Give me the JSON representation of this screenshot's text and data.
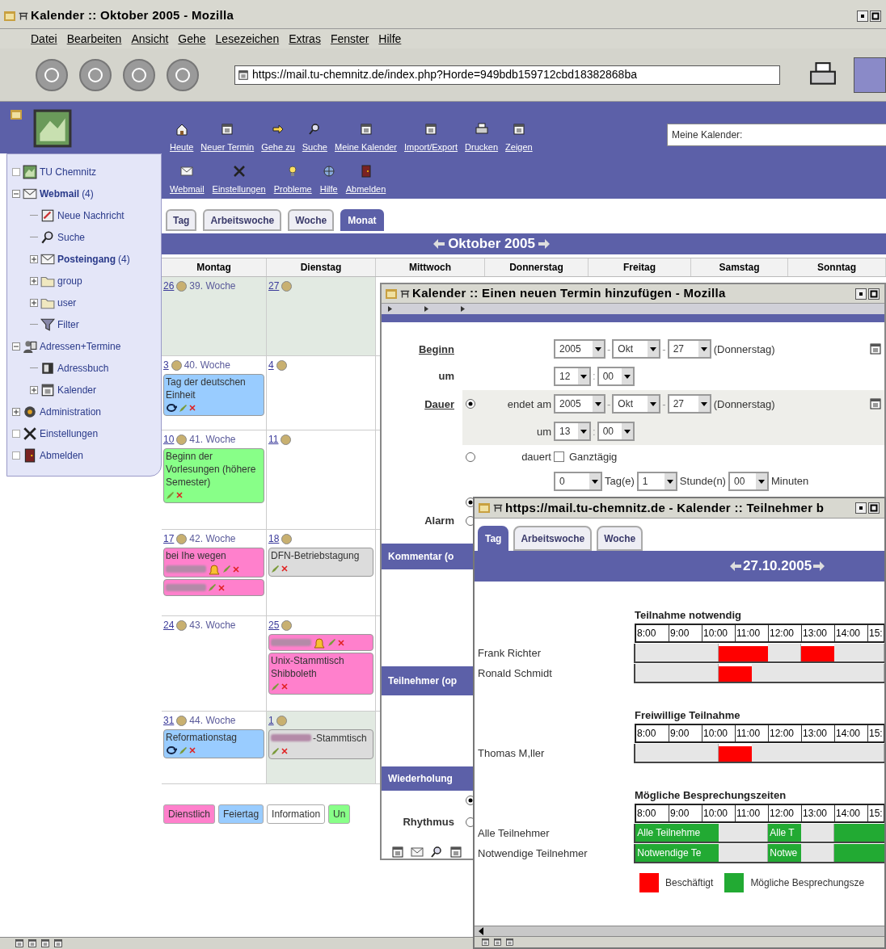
{
  "window": {
    "title": "Kalender :: Oktober 2005 - Mozilla"
  },
  "menu": [
    "Datei",
    "Bearbeiten",
    "Ansicht",
    "Gehe",
    "Lesezeichen",
    "Extras",
    "Fenster",
    "Hilfe"
  ],
  "address_bar": {
    "value": "https://mail.tu-chemnitz.de/index.php?Horde=949bdb159712cbd18382868ba"
  },
  "toolbar": [
    "Heute",
    "Neuer Termin",
    "Gehe zu",
    "Suche",
    "Meine Kalender",
    "Import/Export",
    "Drucken",
    "Zeigen"
  ],
  "toolbar_row2": [
    "Webmail",
    "Einstellungen",
    "Probleme",
    "Hilfe",
    "Abmelden"
  ],
  "calendar_select": {
    "value": "Meine Kalender:"
  },
  "sidebar": {
    "items": [
      {
        "label": "TU Chemnitz",
        "unread": false
      },
      {
        "label": "Webmail",
        "count": "(4)",
        "unread": true,
        "expanded": true,
        "children": [
          {
            "label": "Neue Nachricht",
            "unread": false
          },
          {
            "label": "Suche",
            "unread": false
          },
          {
            "label": "Posteingang",
            "count": "(4)",
            "unread": true,
            "expanded": false
          },
          {
            "label": "group",
            "unread": false,
            "expanded": false
          },
          {
            "label": "user",
            "unread": false,
            "expanded": false
          },
          {
            "label": "Filter",
            "unread": false
          }
        ]
      },
      {
        "label": "Adressen+Termine",
        "unread": false,
        "expanded": true,
        "children": [
          {
            "label": "Adressbuch",
            "unread": false
          },
          {
            "label": "Kalender",
            "unread": false,
            "expanded": false
          }
        ]
      },
      {
        "label": "Administration",
        "unread": false,
        "expanded": false
      },
      {
        "label": "Einstellungen",
        "unread": false
      },
      {
        "label": "Abmelden",
        "unread": false
      }
    ]
  },
  "tabs": [
    {
      "label": "Tag",
      "selected": false
    },
    {
      "label": "Arbeitswoche",
      "selected": false
    },
    {
      "label": "Woche",
      "selected": false
    },
    {
      "label": "Monat",
      "selected": true
    }
  ],
  "month_title": "Oktober 2005",
  "weekdays": [
    "Montag",
    "Dienstag",
    "Mittwoch",
    "Donnerstag",
    "Freitag",
    "Samstag",
    "Sonntag"
  ],
  "weeks": [
    {
      "days": [
        {
          "day": "26",
          "week": "39. Woche",
          "in_month": false
        },
        {
          "day": "27",
          "in_month": false
        }
      ]
    },
    {
      "days": [
        {
          "day": "3",
          "week": "40. Woche",
          "in_month": true,
          "events": [
            {
              "color": "#99ccff",
              "alarm": false,
              "recurring": true,
              "parts": [
                {
                  "kind": "text",
                  "text": "Tag der deutschen Einheit"
                }
              ]
            }
          ]
        },
        {
          "day": "4",
          "in_month": true
        }
      ]
    },
    {
      "days": [
        {
          "day": "10",
          "week": "41. Woche",
          "in_month": true,
          "events": [
            {
              "color": "#88ff88",
              "alarm": false,
              "recurring": false,
              "parts": [
                {
                  "kind": "text",
                  "text": "Beginn der Vorlesungen (höhere Semester)"
                }
              ]
            }
          ]
        },
        {
          "day": "11",
          "in_month": true
        }
      ]
    },
    {
      "days": [
        {
          "day": "17",
          "week": "42. Woche",
          "in_month": true,
          "events": [
            {
              "color": "#ff80cc",
              "alarm": true,
              "recurring": false,
              "parts": [
                {
                  "kind": "text",
                  "text": "bei Ihe wegen"
                },
                {
                  "kind": "blur"
                }
              ]
            },
            {
              "color": "#ff80cc",
              "alarm": false,
              "recurring": false,
              "parts": [
                {
                  "kind": "blur"
                }
              ]
            }
          ]
        },
        {
          "day": "18",
          "in_month": true,
          "events": [
            {
              "color": "#dcdcdc",
              "alarm": false,
              "recurring": false,
              "parts": [
                {
                  "kind": "text",
                  "text": "DFN-Betriebstagung"
                }
              ]
            }
          ]
        }
      ]
    },
    {
      "days": [
        {
          "day": "24",
          "week": "43. Woche",
          "in_month": true
        },
        {
          "day": "25",
          "in_month": true,
          "events": [
            {
              "color": "#ff80cc",
              "alarm": true,
              "recurring": false,
              "parts": [
                {
                  "kind": "blur"
                }
              ]
            },
            {
              "color": "#ff80cc",
              "alarm": false,
              "recurring": false,
              "parts": [
                {
                  "kind": "text",
                  "text": "Unix-Stammtisch Shibboleth"
                }
              ]
            }
          ]
        }
      ]
    },
    {
      "days": [
        {
          "day": "31",
          "week": "44. Woche",
          "in_month": true,
          "events": [
            {
              "color": "#99ccff",
              "alarm": false,
              "recurring": true,
              "parts": [
                {
                  "kind": "text",
                  "text": "Reformationstag"
                }
              ]
            }
          ]
        },
        {
          "day": "1",
          "in_month": false,
          "events": [
            {
              "color": "#dcdcdc",
              "alarm": false,
              "recurring": false,
              "parts": [
                {
                  "kind": "blur"
                },
                {
                  "kind": "text",
                  "text": "-Stammtisch"
                }
              ]
            }
          ]
        }
      ]
    }
  ],
  "legend": [
    {
      "label": "Dienstlich",
      "color": "#ff80cc"
    },
    {
      "label": "Feiertag",
      "color": "#99ccff"
    },
    {
      "label": "Information",
      "color": "#ffffff"
    },
    {
      "label": "Un",
      "color": "#88ff88"
    }
  ],
  "new_event_dialog": {
    "title": "Kalender :: Einen neuen Termin hinzufügen - Mozilla",
    "begin_label": "Beginn",
    "at_label": "um",
    "date_separator": "-",
    "time_separator": ":",
    "start_date": [
      "2005",
      "Okt",
      "27"
    ],
    "start_weekday": "(Donnerstag)",
    "start_time": [
      "12",
      "00"
    ],
    "duration_label": "Dauer",
    "end_option": {
      "label": "endet am",
      "selected": true
    },
    "end_date": [
      "2005",
      "Okt",
      "27"
    ],
    "end_weekday": "(Donnerstag)",
    "end_at_label": "um",
    "end_time": [
      "13",
      "00"
    ],
    "length_option": {
      "label": "dauert",
      "selected": false
    },
    "all_day": {
      "label": "Ganztägig",
      "checked": false
    },
    "length": [
      {
        "value": "0",
        "unit": "Tag(e)"
      },
      {
        "value": "1",
        "unit": "Stunde(n)"
      },
      {
        "value": "00",
        "unit": "Minuten"
      }
    ],
    "alarm_label": "Alarm",
    "alarm_options": [
      {
        "selected": true
      },
      {
        "selected": false
      }
    ],
    "comment_header": "Kommentar (o",
    "attendees_header": "Teilnehmer (op",
    "recurrence_header": "Wiederholung",
    "recurrence_options": [
      {
        "selected": true
      },
      {
        "selected": false
      }
    ],
    "rhythm_label": "Rhythmus"
  },
  "attendees_dialog": {
    "title": "https://mail.tu-chemnitz.de - Kalender :: Teilnehmer b",
    "tabs": [
      {
        "label": "Tag",
        "selected": true
      },
      {
        "label": "Arbeitswoche",
        "selected": false
      },
      {
        "label": "Woche",
        "selected": false
      }
    ],
    "date": "27.10.2005",
    "sections": [
      {
        "title": "Teilnahme notwendig",
        "hours": [
          "8:00",
          "9:00",
          "10:00",
          "11:00",
          "12:00",
          "13:00",
          "14:00",
          "15:"
        ],
        "rows": [
          {
            "name": "Frank Richter",
            "slots": [
              {
                "kind": "free"
              },
              {
                "kind": "free"
              },
              {
                "kind": "free"
              },
              {
                "kind": "free"
              },
              {
                "kind": "free"
              },
              {
                "kind": "busy"
              },
              {
                "kind": "busy"
              },
              {
                "kind": "busy"
              },
              {
                "kind": "free"
              },
              {
                "kind": "free"
              },
              {
                "kind": "busy"
              },
              {
                "kind": "busy"
              },
              {
                "kind": "free"
              },
              {
                "kind": "free"
              },
              {
                "kind": "free"
              }
            ]
          },
          {
            "name": "Ronald Schmidt",
            "slots": [
              {
                "kind": "free"
              },
              {
                "kind": "free"
              },
              {
                "kind": "free"
              },
              {
                "kind": "free"
              },
              {
                "kind": "free"
              },
              {
                "kind": "busy"
              },
              {
                "kind": "busy"
              },
              {
                "kind": "free"
              },
              {
                "kind": "free"
              },
              {
                "kind": "free"
              },
              {
                "kind": "free"
              },
              {
                "kind": "free"
              },
              {
                "kind": "free"
              },
              {
                "kind": "free"
              },
              {
                "kind": "free"
              }
            ]
          }
        ]
      },
      {
        "title": "Freiwillige Teilnahme",
        "hours": [
          "8:00",
          "9:00",
          "10:00",
          "11:00",
          "12:00",
          "13:00",
          "14:00",
          "15:"
        ],
        "rows": [
          {
            "name": "Thomas M,ller",
            "slots": [
              {
                "kind": "free"
              },
              {
                "kind": "free"
              },
              {
                "kind": "free"
              },
              {
                "kind": "free"
              },
              {
                "kind": "free"
              },
              {
                "kind": "busy"
              },
              {
                "kind": "busy"
              },
              {
                "kind": "free"
              },
              {
                "kind": "free"
              },
              {
                "kind": "free"
              },
              {
                "kind": "free"
              },
              {
                "kind": "free"
              },
              {
                "kind": "free"
              },
              {
                "kind": "free"
              },
              {
                "kind": "free"
              }
            ]
          }
        ]
      },
      {
        "title": "Mögliche Besprechungszeiten",
        "hours": [
          "8:00",
          "9:00",
          "10:00",
          "11:00",
          "12:00",
          "13:00",
          "14:00",
          "15:"
        ],
        "rows": [
          {
            "name": "Alle Teilnehmer",
            "slots": [
              {
                "kind": "possible",
                "label": "Alle Teilnehme"
              },
              {
                "kind": "possible"
              },
              {
                "kind": "possible"
              },
              {
                "kind": "possible"
              },
              {
                "kind": "possible"
              },
              {
                "kind": "free"
              },
              {
                "kind": "free"
              },
              {
                "kind": "free"
              },
              {
                "kind": "possible",
                "label": "Alle T"
              },
              {
                "kind": "possible"
              },
              {
                "kind": "free"
              },
              {
                "kind": "free"
              },
              {
                "kind": "possible"
              },
              {
                "kind": "possible"
              },
              {
                "kind": "possible"
              }
            ]
          },
          {
            "name": "Notwendige Teilnehmer",
            "slots": [
              {
                "kind": "possible",
                "label": "Notwendige Te"
              },
              {
                "kind": "possible"
              },
              {
                "kind": "possible"
              },
              {
                "kind": "possible"
              },
              {
                "kind": "possible"
              },
              {
                "kind": "free"
              },
              {
                "kind": "free"
              },
              {
                "kind": "free"
              },
              {
                "kind": "possible",
                "label": "Notwe"
              },
              {
                "kind": "possible"
              },
              {
                "kind": "free"
              },
              {
                "kind": "free"
              },
              {
                "kind": "possible"
              },
              {
                "kind": "possible"
              },
              {
                "kind": "possible"
              }
            ]
          }
        ]
      }
    ],
    "legend": [
      {
        "label": "Beschäftigt",
        "color": "#ff0000"
      },
      {
        "label": "Mögliche Besprechungsze",
        "color": "#22aa33"
      }
    ]
  }
}
